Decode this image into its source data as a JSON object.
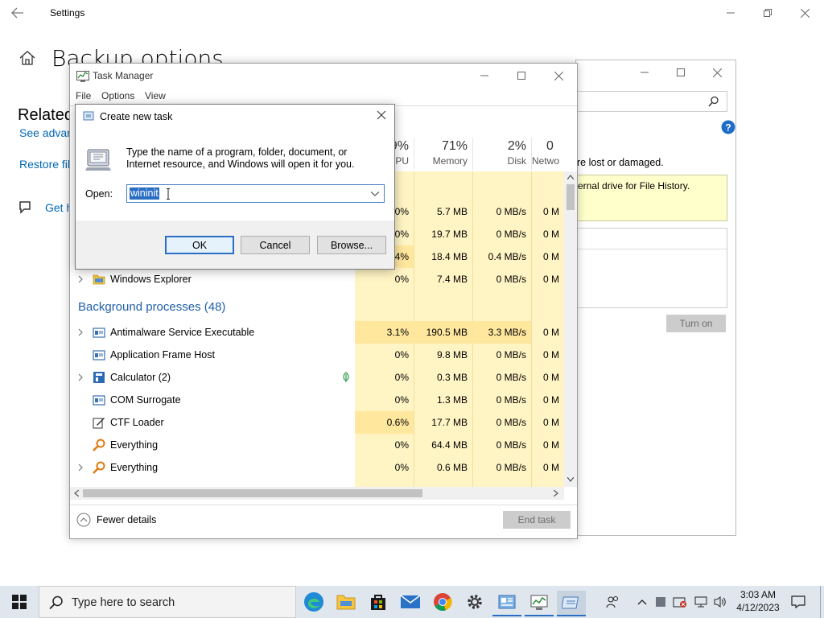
{
  "settings": {
    "title": "Settings",
    "page_title": "Backup options",
    "related": "Related",
    "links": [
      "See advan",
      "Restore fil"
    ],
    "help": "Get h"
  },
  "file_history": {
    "notice_partial": "re lost or damaged.",
    "yellow_text": "ernal drive for File History.",
    "turn_on": "Turn on"
  },
  "task_manager": {
    "title": "Task Manager",
    "menu": [
      "File",
      "Options",
      "View"
    ],
    "columns": [
      {
        "pct": "9%",
        "label": "PU"
      },
      {
        "pct": "71%",
        "label": "Memory"
      },
      {
        "pct": "2%",
        "label": "Disk"
      },
      {
        "pct": "0",
        "label": "Netwo"
      }
    ],
    "top_rows": [
      {
        "cpu": "0%",
        "mem": "5.7 MB",
        "disk": "0 MB/s",
        "net": "0 M"
      },
      {
        "cpu": "0%",
        "mem": "19.7 MB",
        "disk": "0 MB/s",
        "net": "0 M"
      },
      {
        "cpu": "4%",
        "mem": "18.4 MB",
        "disk": "0.4 MB/s",
        "net": "0 M"
      }
    ],
    "explorer": {
      "name": "Windows Explorer",
      "cpu": "0%",
      "mem": "7.4 MB",
      "disk": "0 MB/s",
      "net": "0 M"
    },
    "background_header": "Background processes (48)",
    "processes": [
      {
        "name": "Antimalware Service Executable",
        "cpu": "3.1%",
        "mem": "190.5 MB",
        "disk": "3.3 MB/s",
        "net": "0 M"
      },
      {
        "name": "Application Frame Host",
        "cpu": "0%",
        "mem": "9.8 MB",
        "disk": "0 MB/s",
        "net": "0 M"
      },
      {
        "name": "Calculator (2)",
        "cpu": "0%",
        "mem": "0.3 MB",
        "disk": "0 MB/s",
        "net": "0 M"
      },
      {
        "name": "COM Surrogate",
        "cpu": "0%",
        "mem": "1.3 MB",
        "disk": "0 MB/s",
        "net": "0 M"
      },
      {
        "name": "CTF Loader",
        "cpu": "0.6%",
        "mem": "17.7 MB",
        "disk": "0 MB/s",
        "net": "0 M"
      },
      {
        "name": "Everything",
        "cpu": "0%",
        "mem": "64.4 MB",
        "disk": "0 MB/s",
        "net": "0 M"
      },
      {
        "name": "Everything",
        "cpu": "0%",
        "mem": "0.6 MB",
        "disk": "0 MB/s",
        "net": "0 M"
      }
    ],
    "fewer_details": "Fewer details",
    "end_task": "End task"
  },
  "run_dialog": {
    "title": "Create new task",
    "description": "Type the name of a program, folder, document, or Internet resource, and Windows will open it for you.",
    "open_label": "Open:",
    "open_value": "wininit",
    "ok": "OK",
    "cancel": "Cancel",
    "browse": "Browse..."
  },
  "taskbar": {
    "search_placeholder": "Type here to search",
    "time": "3:03 AM",
    "date": "4/12/2023"
  }
}
